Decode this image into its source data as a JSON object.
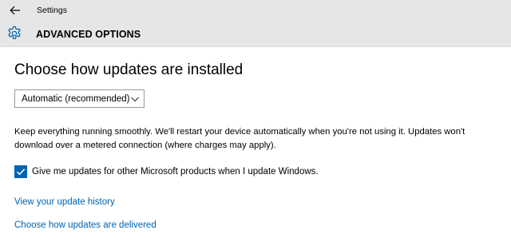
{
  "titlebar": {
    "back_icon": "back-arrow-icon",
    "app_title": "Settings"
  },
  "header": {
    "icon": "gear-icon",
    "title": "ADVANCED OPTIONS"
  },
  "main": {
    "section_title": "Choose how updates are installed",
    "install_mode": {
      "selected": "Automatic (recommended)",
      "icon": "chevron-down-icon"
    },
    "description": "Keep everything running smoothly. We'll restart your device automatically when you're not using it. Updates won't download over a metered connection (where charges may apply).",
    "ms_products_checkbox": {
      "label": "Give me updates for other Microsoft products when I update Windows.",
      "checked": true
    },
    "links": {
      "update_history": "View your update history",
      "delivery": "Choose how updates are delivered"
    }
  },
  "colors": {
    "accent": "#0063b1",
    "header_bg": "#e6e6e6",
    "content_bg": "#ffffff"
  }
}
